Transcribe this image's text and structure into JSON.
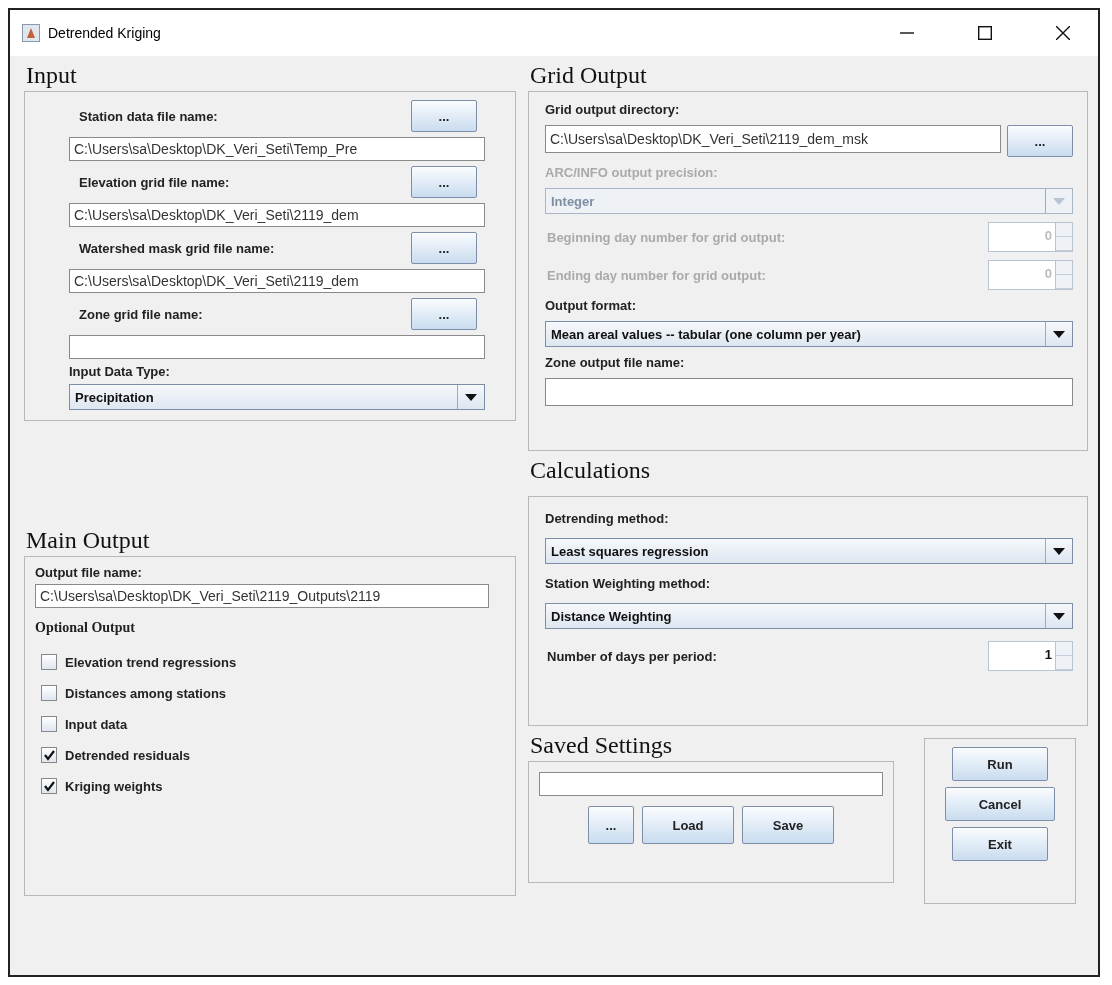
{
  "window": {
    "title": "Detrended Kriging"
  },
  "input": {
    "title": "Input",
    "files": [
      {
        "label": "Station data file name:",
        "button": "...",
        "value": "C:\\Users\\sa\\Desktop\\DK_Veri_Seti\\Temp_Pre"
      },
      {
        "label": "Elevation grid file name:",
        "button": "...",
        "value": "C:\\Users\\sa\\Desktop\\DK_Veri_Seti\\2119_dem"
      },
      {
        "label": "Watershed mask grid file name:",
        "button": "...",
        "value": "C:\\Users\\sa\\Desktop\\DK_Veri_Seti\\2119_dem"
      },
      {
        "label": "Zone grid file name:",
        "button": "..."
      }
    ],
    "data_type": {
      "label": "Input Data Type:",
      "value": "Precipitation"
    }
  },
  "main_output": {
    "title": "Main Output",
    "file_label": "Output file name:",
    "file_value": "C:\\Users\\sa\\Desktop\\DK_Veri_Seti\\2119_Outputs\\2119",
    "optional_title": "Optional Output",
    "options": [
      {
        "label": "Elevation trend regressions",
        "checked": false
      },
      {
        "label": "Distances among stations",
        "checked": false
      },
      {
        "label": "Input data",
        "checked": false
      },
      {
        "label": "Detrended residuals",
        "checked": true
      },
      {
        "label": "Kriging weights",
        "checked": true
      }
    ]
  },
  "grid_output": {
    "title": "Grid Output",
    "directory_label": "Grid output directory:",
    "directory_value": "C:\\Users\\sa\\Desktop\\DK_Veri_Seti\\2119_dem_msk",
    "directory_button": "...",
    "precision": {
      "label": "ARC/INFO output precision:",
      "value": "Integer",
      "disabled": true
    },
    "days": [
      {
        "label": "Beginning day number for grid output:",
        "value": "0",
        "disabled": true
      },
      {
        "label": "Ending day number for grid output:",
        "value": "0",
        "disabled": true
      }
    ],
    "format": {
      "label": "Output format:",
      "value": "Mean areal values -- tabular (one column per year)"
    },
    "zone_label": "Zone output file name:"
  },
  "calculations": {
    "title": "Calculations",
    "detrending": {
      "label": "Detrending method:",
      "value": "Least squares regression"
    },
    "weighting": {
      "label": "Station Weighting method:",
      "value": "Distance Weighting"
    },
    "period": {
      "label": "Number of days per period:",
      "value": "1",
      "disabled": false
    }
  },
  "saved_settings": {
    "title": "Saved Settings",
    "buttons": [
      "...",
      "Load",
      "Save"
    ]
  },
  "actions": [
    "Run",
    "Cancel",
    "Exit"
  ]
}
